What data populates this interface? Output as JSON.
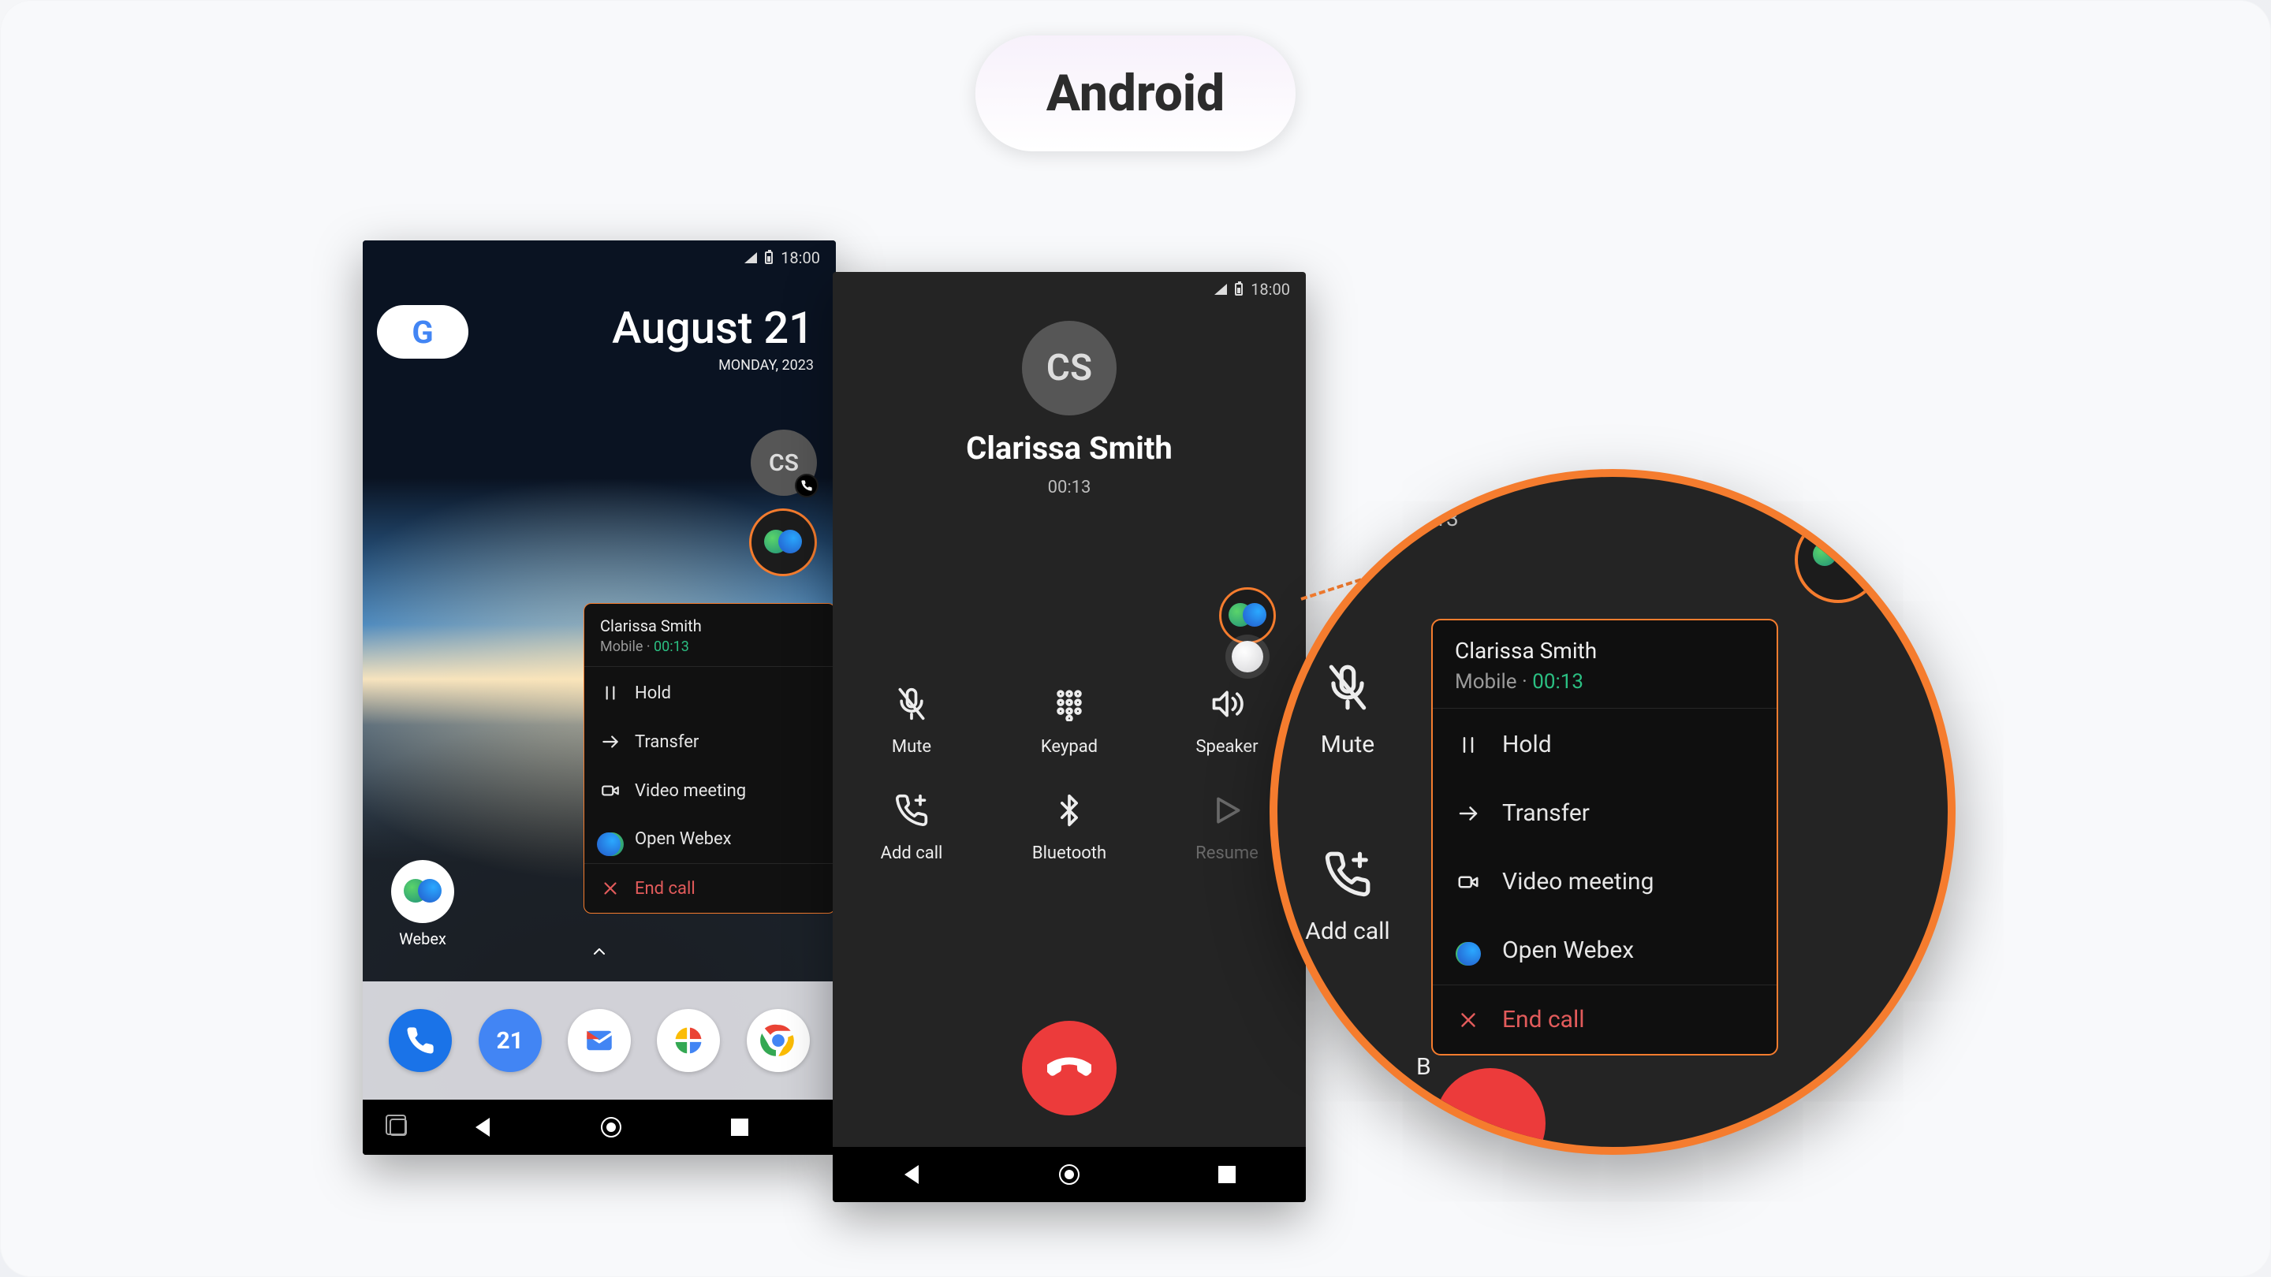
{
  "platform_label": "Android",
  "status_time": "18:00",
  "home": {
    "date": "August 21",
    "day_line": "MONDAY, 2023",
    "cs_initials": "CS",
    "webex_app_label": "Webex",
    "dock_calendar_day": "21"
  },
  "ctx": {
    "name": "Clarissa Smith",
    "type": "Mobile",
    "sep": " · ",
    "timer": "00:13",
    "hold": "Hold",
    "transfer": "Transfer",
    "video": "Video meeting",
    "open": "Open Webex",
    "end": "End call"
  },
  "call": {
    "initials": "CS",
    "name": "Clarissa Smith",
    "timer": "00:13",
    "mute": "Mute",
    "keypad": "Keypad",
    "speaker": "Speaker",
    "addcall": "Add call",
    "bluetooth": "Bluetooth",
    "resume": "Resume",
    "bluetooth_short": "B"
  }
}
